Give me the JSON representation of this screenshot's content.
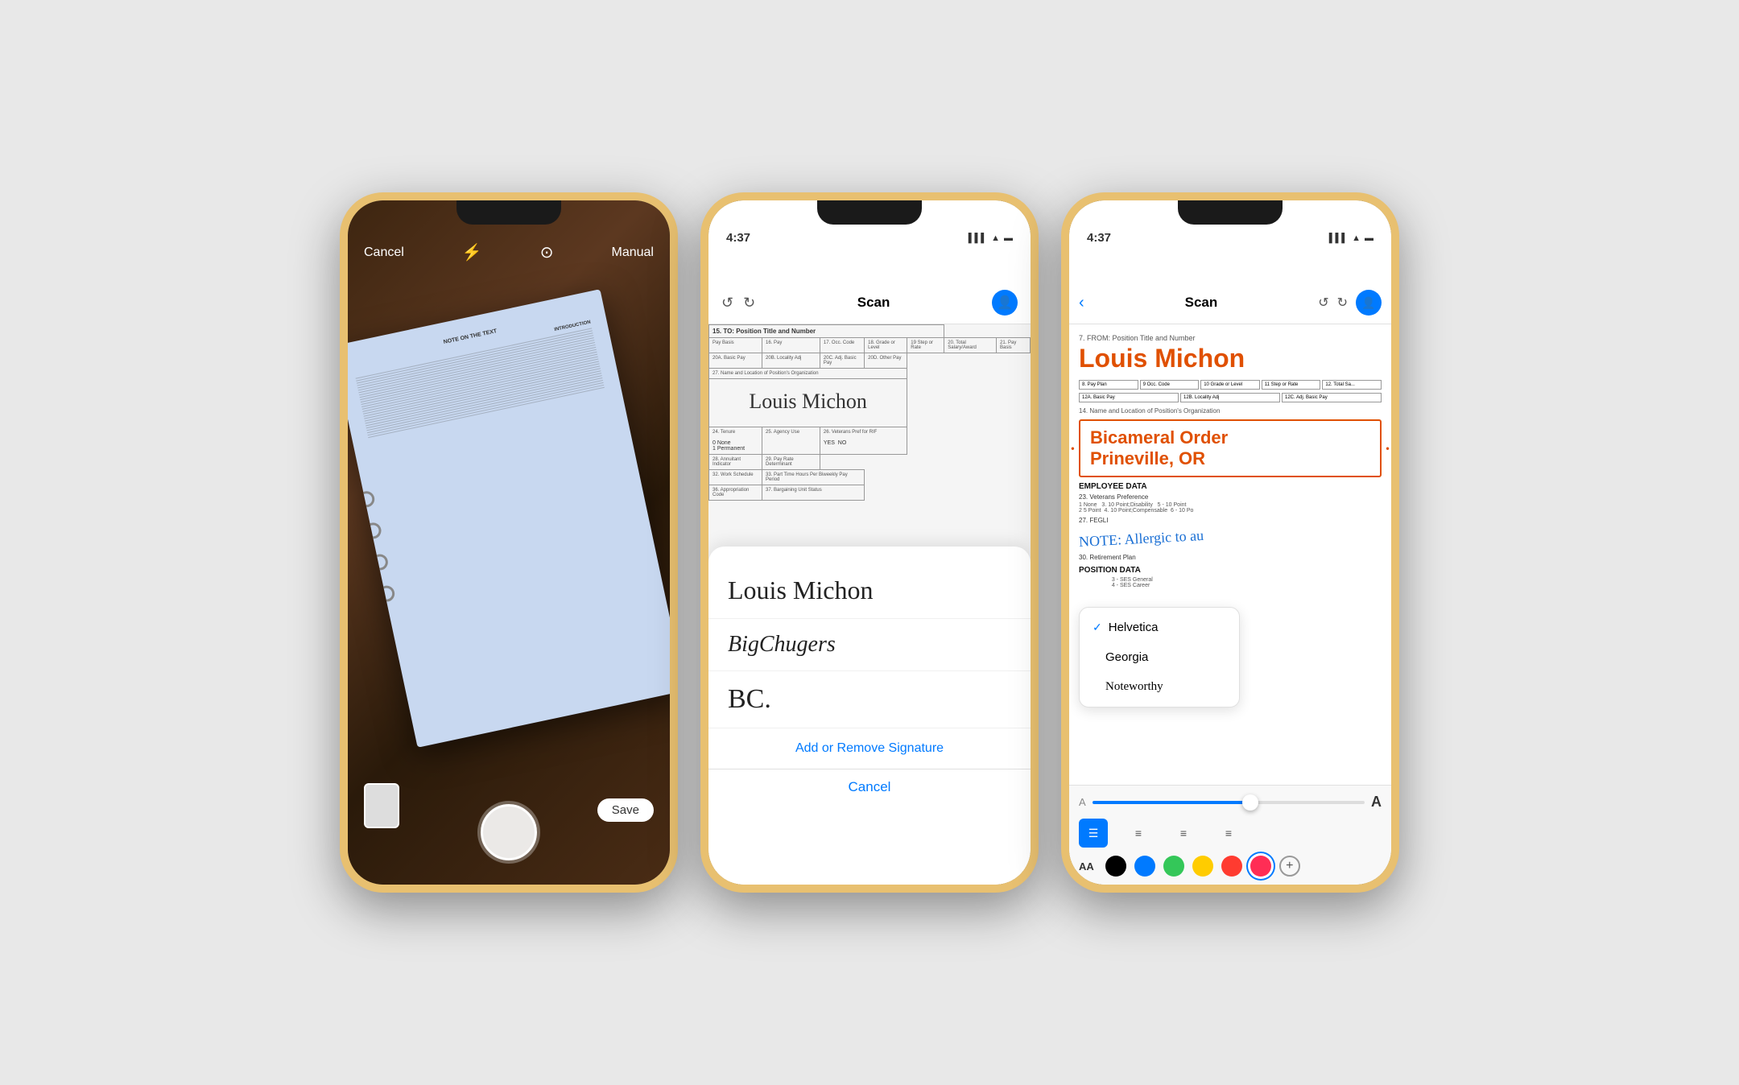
{
  "background": "#e8e8e8",
  "phones": {
    "phone1": {
      "type": "camera",
      "status": {
        "time": "",
        "icons": [
          "signal",
          "wifi",
          "battery"
        ]
      },
      "ui": {
        "cancel_label": "Cancel",
        "manual_label": "Manual",
        "save_label": "Save"
      }
    },
    "phone2": {
      "type": "scan-signature",
      "status": {
        "time": "4:37"
      },
      "header": {
        "title": "Scan"
      },
      "form": {
        "field_label_15": "15. TO: Position Title and Number",
        "field_label_24": "24. Tenure",
        "field_label_25": "25. Agency Use",
        "field_label_26": "26. Veterans Pref for RIF",
        "field_label_28": "28. Annuitant Indicator",
        "field_label_29": "29. Pay Rate Determinant",
        "field_label_32": "32. Work Schedule",
        "field_label_33": "33. Part Time Hours Per Biweekly Pay Period",
        "field_label_36": "36. Appropriation Code",
        "field_label_37": "37. Bargaining Unit Status",
        "signature_on_form": "Louis Michon"
      },
      "signature_panel": {
        "sig1": "Louis Michon",
        "sig2": "BigChugers",
        "sig3": "BC.",
        "add_remove_label": "Add or Remove Signature",
        "cancel_label": "Cancel"
      }
    },
    "phone3": {
      "type": "annotate",
      "status": {
        "time": "4:37"
      },
      "header": {
        "title": "Scan"
      },
      "doc": {
        "from_label": "7. FROM: Position Title and Number",
        "big_name": "Louis Michon",
        "location_line1": "Bicameral Order",
        "location_line2": "Prineville, OR",
        "employee_data": "EMPLOYEE DATA",
        "position_data": "POSITION DATA",
        "veterans_label": "23. Veterans Preference",
        "note_text": "NOTE: Allergic to au"
      },
      "font_picker": {
        "options": [
          {
            "name": "Helvetica",
            "selected": true
          },
          {
            "name": "Georgia",
            "selected": false
          },
          {
            "name": "Noteworthy",
            "selected": false
          }
        ]
      },
      "toolbar": {
        "font_size_small": "A",
        "font_size_large": "A",
        "aa_label": "AA",
        "align_options": [
          "left",
          "center",
          "right",
          "justify"
        ],
        "colors": [
          {
            "color": "#000000",
            "selected": false
          },
          {
            "color": "#007aff",
            "selected": false
          },
          {
            "color": "#34c759",
            "selected": false
          },
          {
            "color": "#ffcc00",
            "selected": false
          },
          {
            "color": "#ff3b30",
            "selected": false
          },
          {
            "color": "#ff2d55",
            "selected": true
          }
        ]
      }
    }
  }
}
